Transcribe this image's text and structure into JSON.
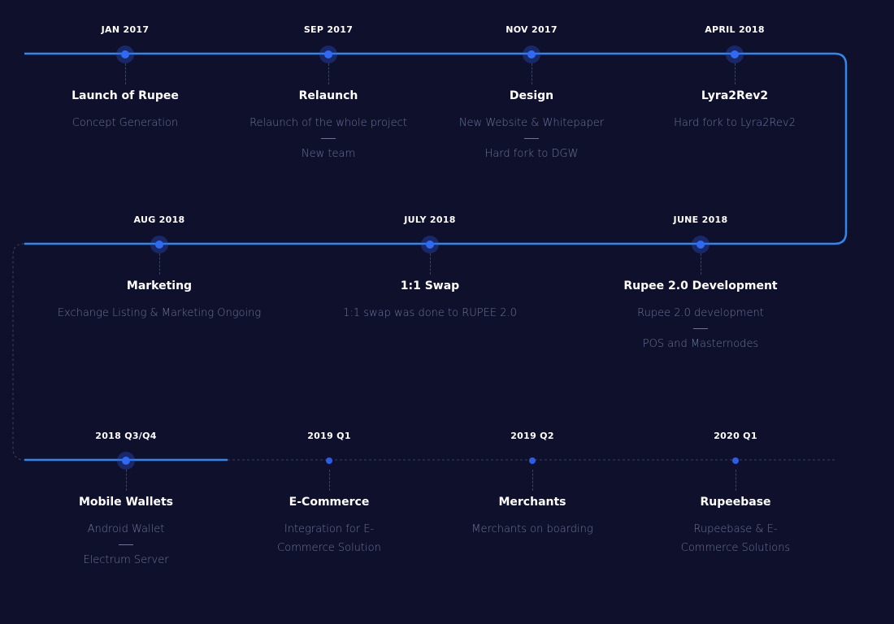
{
  "colors": {
    "background": "#0f102b",
    "line": "#2f88f0",
    "node": "#2f6af5",
    "text_primary": "#ffffff",
    "text_secondary": "#6d7599"
  },
  "rows": [
    {
      "milestones": [
        {
          "date": "JAN 2017",
          "title": "Launch of Rupee",
          "desc": [
            "Concept Generation"
          ],
          "completed": true
        },
        {
          "date": "SEP 2017",
          "title": "Relaunch",
          "desc": [
            "Relaunch of the whole project",
            "New team"
          ],
          "completed": true
        },
        {
          "date": "NOV 2017",
          "title": "Design",
          "desc": [
            "New Website & Whitepaper",
            "Hard fork to DGW"
          ],
          "completed": true
        },
        {
          "date": "APRIL 2018",
          "title": "Lyra2Rev2",
          "desc": [
            "Hard fork to Lyra2Rev2"
          ],
          "completed": true
        }
      ]
    },
    {
      "milestones": [
        {
          "date": "AUG 2018",
          "title": "Marketing",
          "desc": [
            "Exchange Listing & Marketing Ongoing"
          ],
          "completed": true
        },
        {
          "date": "JULY 2018",
          "title": "1:1 Swap",
          "desc": [
            "1:1 swap was done to RUPEE 2.0"
          ],
          "completed": true
        },
        {
          "date": "JUNE 2018",
          "title": "Rupee 2.0 Development",
          "desc": [
            "Rupee 2.0 development",
            "POS and Masternodes"
          ],
          "completed": true
        }
      ]
    },
    {
      "milestones": [
        {
          "date": "2018 Q3/Q4",
          "title": "Mobile Wallets",
          "desc": [
            "Android Wallet",
            "Electrum Server"
          ],
          "completed": true
        },
        {
          "date": "2019 Q1",
          "title": "E-Commerce",
          "desc": [
            "Integration for E-Commerce Solution"
          ],
          "completed": false
        },
        {
          "date": "2019 Q2",
          "title": "Merchants",
          "desc": [
            "Merchants on boarding"
          ],
          "completed": false
        },
        {
          "date": "2020 Q1",
          "title": "Rupeebase",
          "desc": [
            "Rupeebase & E-Commerce Solutions"
          ],
          "completed": false
        }
      ]
    }
  ]
}
